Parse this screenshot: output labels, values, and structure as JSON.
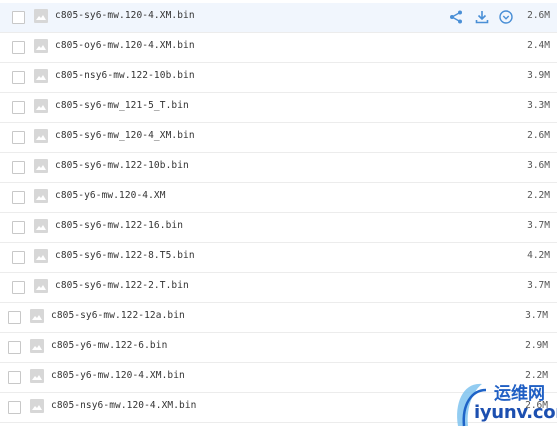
{
  "files": [
    {
      "name": "c805-sy6-mw.120-4.XM.bin",
      "size": "2.6M",
      "highlighted": true
    },
    {
      "name": "c805-oy6-mw.120-4.XM.bin",
      "size": "2.4M"
    },
    {
      "name": "c805-nsy6-mw.122-10b.bin",
      "size": "3.9M"
    },
    {
      "name": "c805-sy6-mw_121-5_T.bin",
      "size": "3.3M"
    },
    {
      "name": "c805-sy6-mw_120-4_XM.bin",
      "size": "2.6M"
    },
    {
      "name": "c805-sy6-mw.122-10b.bin",
      "size": "3.6M"
    },
    {
      "name": "c805-y6-mw.120-4.XM",
      "size": "2.2M"
    },
    {
      "name": "c805-sy6-mw.122-16.bin",
      "size": "3.7M"
    },
    {
      "name": "c805-sy6-mw.122-8.T5.bin",
      "size": "4.2M"
    },
    {
      "name": "c805-sy6-mw.122-2.T.bin",
      "size": "3.7M"
    },
    {
      "name": "c805-sy6-mw.122-12a.bin",
      "size": "3.7M"
    },
    {
      "name": "c805-y6-mw.122-6.bin",
      "size": "2.9M"
    },
    {
      "name": "c805-y6-mw.120-4.XM.bin",
      "size": "2.2M"
    },
    {
      "name": "c805-nsy6-mw.120-4.XM.bin",
      "size": "2.6M"
    }
  ],
  "row_actions": {
    "share_icon": "share-icon",
    "download_icon": "download-icon",
    "more_icon": "chevron-down-circle-icon"
  },
  "watermark": {
    "cn_text": "运维网",
    "url_text": "iyunv.com"
  },
  "colors": {
    "highlight_row": "#f1f6fd",
    "action_icon": "#4a8fd6",
    "watermark_blue": "#1c4fb0"
  }
}
